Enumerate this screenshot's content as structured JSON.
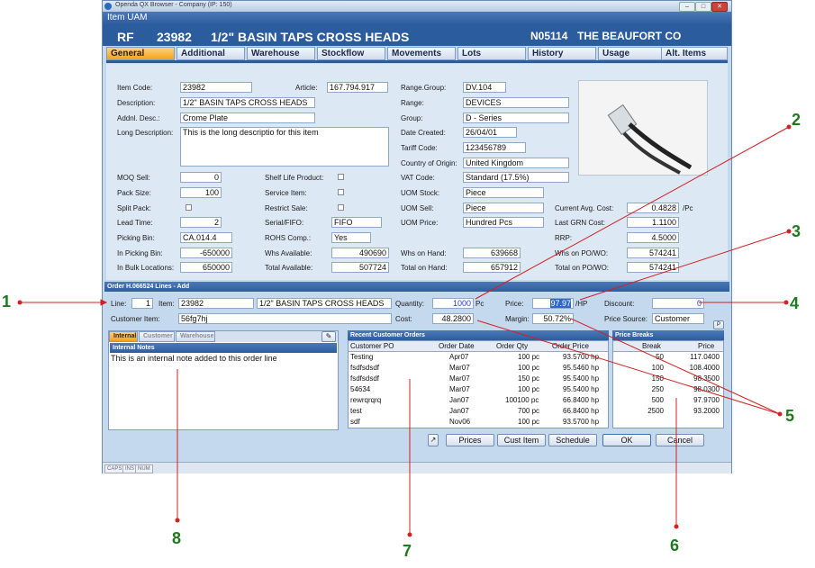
{
  "window": {
    "title": "Openda QX Browser - Company (IP: 150)",
    "header": "Item UAM"
  },
  "item": {
    "prefix": "RF",
    "code": "23982",
    "description": "1/2\" BASIN TAPS CROSS HEADS",
    "account_code": "N05114",
    "account_name": "THE BEAUFORT CO"
  },
  "tabs": [
    "General",
    "Additional",
    "Warehouse",
    "Stockflow",
    "Movements",
    "Lots",
    "History",
    "Usage",
    "Alt. Items"
  ],
  "general": {
    "item_code_label": "Item Code:",
    "item_code": "23982",
    "article_label": "Article:",
    "article": "167.794.917",
    "description_label": "Description:",
    "description": "1/2\" BASIN TAPS CROSS HEADS",
    "addnl_desc_label": "Addnl. Desc.:",
    "addnl_desc": "Crome Plate",
    "long_desc_label": "Long Description:",
    "long_desc": "This is the long descriptio for this item",
    "moq_sell_label": "MOQ Sell:",
    "moq_sell": "0",
    "pack_size_label": "Pack Size:",
    "pack_size": "100",
    "split_pack_label": "Split Pack:",
    "lead_time_label": "Lead Time:",
    "lead_time": "2",
    "picking_bin_label": "Picking Bin:",
    "picking_bin": "CA.014.4",
    "in_picking_bin_label": "In Picking Bin:",
    "in_picking_bin": "-650000",
    "in_bulk_label": "In Bulk Locations:",
    "in_bulk": "650000",
    "shelf_life_label": "Shelf Life Product:",
    "service_item_label": "Service Item:",
    "restrict_sale_label": "Restrict Sale:",
    "serial_fifo_label": "Serial/FIFO:",
    "serial_fifo": "FIFO",
    "rohs_label": "ROHS Comp.:",
    "rohs": "Yes",
    "whs_available_label": "Whs Available:",
    "whs_available": "490690",
    "total_available_label": "Total Available:",
    "total_available": "507724",
    "range_group_label": "Range.Group:",
    "range_group": "DV.104",
    "range_label": "Range:",
    "range": "DEVICES",
    "group_label": "Group:",
    "group": "D - Series",
    "date_created_label": "Date Created:",
    "date_created": "26/04/01",
    "tariff_label": "Tariff Code:",
    "tariff": "123456789",
    "country_label": "Country of Origin:",
    "country": "United Kingdom",
    "vat_label": "VAT Code:",
    "vat": "Standard (17.5%)",
    "uom_stock_label": "UOM Stock:",
    "uom_stock": "Piece",
    "uom_sell_label": "UOM Sell:",
    "uom_sell": "Piece",
    "uom_price_label": "UOM Price:",
    "uom_price": "Hundred Pcs",
    "whs_on_hand_label": "Whs on Hand:",
    "whs_on_hand": "639668",
    "total_on_hand_label": "Total on Hand:",
    "total_on_hand": "657912",
    "avg_cost_label": "Current Avg. Cost:",
    "avg_cost": "0.4828",
    "avg_cost_unit": "/Pc",
    "last_grn_label": "Last GRN Cost:",
    "last_grn": "1.1100",
    "rrp_label": "RRP:",
    "rrp": "4.5000",
    "whs_on_po_label": "Whs on PO/WO:",
    "whs_on_po": "574241",
    "total_on_po_label": "Total on PO/WO:",
    "total_on_po": "574241"
  },
  "order": {
    "header": "Order H.066524 Lines - Add",
    "line_label": "Line:",
    "line": "1",
    "item_label": "Item:",
    "item": "23982",
    "item_desc": "1/2\" BASIN TAPS CROSS HEADS",
    "customer_item_label": "Customer Item:",
    "customer_item": "56fg7hj",
    "quantity_label": "Quantity:",
    "quantity": "1000",
    "quantity_unit": "Pc",
    "cost_label": "Cost:",
    "cost": "48.2800",
    "price_label": "Price:",
    "price": "97.97",
    "price_unit": "/HP",
    "margin_label": "Margin:",
    "margin": "50.72%",
    "discount_label": "Discount:",
    "discount": "0",
    "price_source_label": "Price Source:",
    "price_source": "Customer"
  },
  "notes": {
    "tabs": [
      "Internal",
      "Customer",
      "Warehouse"
    ],
    "header": "Internal Notes",
    "text": "This is an internal note added to this order line"
  },
  "recent_orders": {
    "title": "Recent Customer Orders",
    "columns": [
      "Customer PO",
      "Order Date",
      "Order Qty",
      "Order Price"
    ],
    "rows": [
      {
        "po": "Testing",
        "date": "Apr07",
        "qty": "100 pc",
        "price": "93.5700 hp"
      },
      {
        "po": "fsdfsdsdf",
        "date": "Mar07",
        "qty": "100 pc",
        "price": "95.5460 hp"
      },
      {
        "po": "fsdfsdsdf",
        "date": "Mar07",
        "qty": "150 pc",
        "price": "95.5400 hp"
      },
      {
        "po": "54634",
        "date": "Mar07",
        "qty": "100 pc",
        "price": "95.5400 hp"
      },
      {
        "po": "rewrqrqrq",
        "date": "Jan07",
        "qty": "100100 pc",
        "price": "66.8400 hp"
      },
      {
        "po": "test",
        "date": "Jan07",
        "qty": "700 pc",
        "price": "66.8400 hp"
      },
      {
        "po": "sdf",
        "date": "Nov06",
        "qty": "100 pc",
        "price": "93.5700 hp"
      }
    ]
  },
  "price_breaks": {
    "title": "Price Breaks",
    "columns": [
      "Break",
      "Price"
    ],
    "rows": [
      {
        "break": "50",
        "price": "117.0400"
      },
      {
        "break": "100",
        "price": "108.4000"
      },
      {
        "break": "150",
        "price": "98.3500"
      },
      {
        "break": "250",
        "price": "98.0300"
      },
      {
        "break": "500",
        "price": "97.9700"
      },
      {
        "break": "2500",
        "price": "93.2000"
      }
    ]
  },
  "buttons": {
    "prices": "Prices",
    "cust_item": "Cust Item",
    "schedule": "Schedule",
    "ok": "OK",
    "cancel": "Cancel"
  },
  "status": [
    "CAPS",
    "INS",
    "NUM"
  ],
  "callouts": [
    "1",
    "2",
    "3",
    "4",
    "5",
    "6",
    "7",
    "8"
  ],
  "colors": {
    "accent": "#2b5c9e",
    "tab_active": "#f3a21a",
    "callout_line": "#d32020",
    "callout_text": "#1f7a1f"
  }
}
